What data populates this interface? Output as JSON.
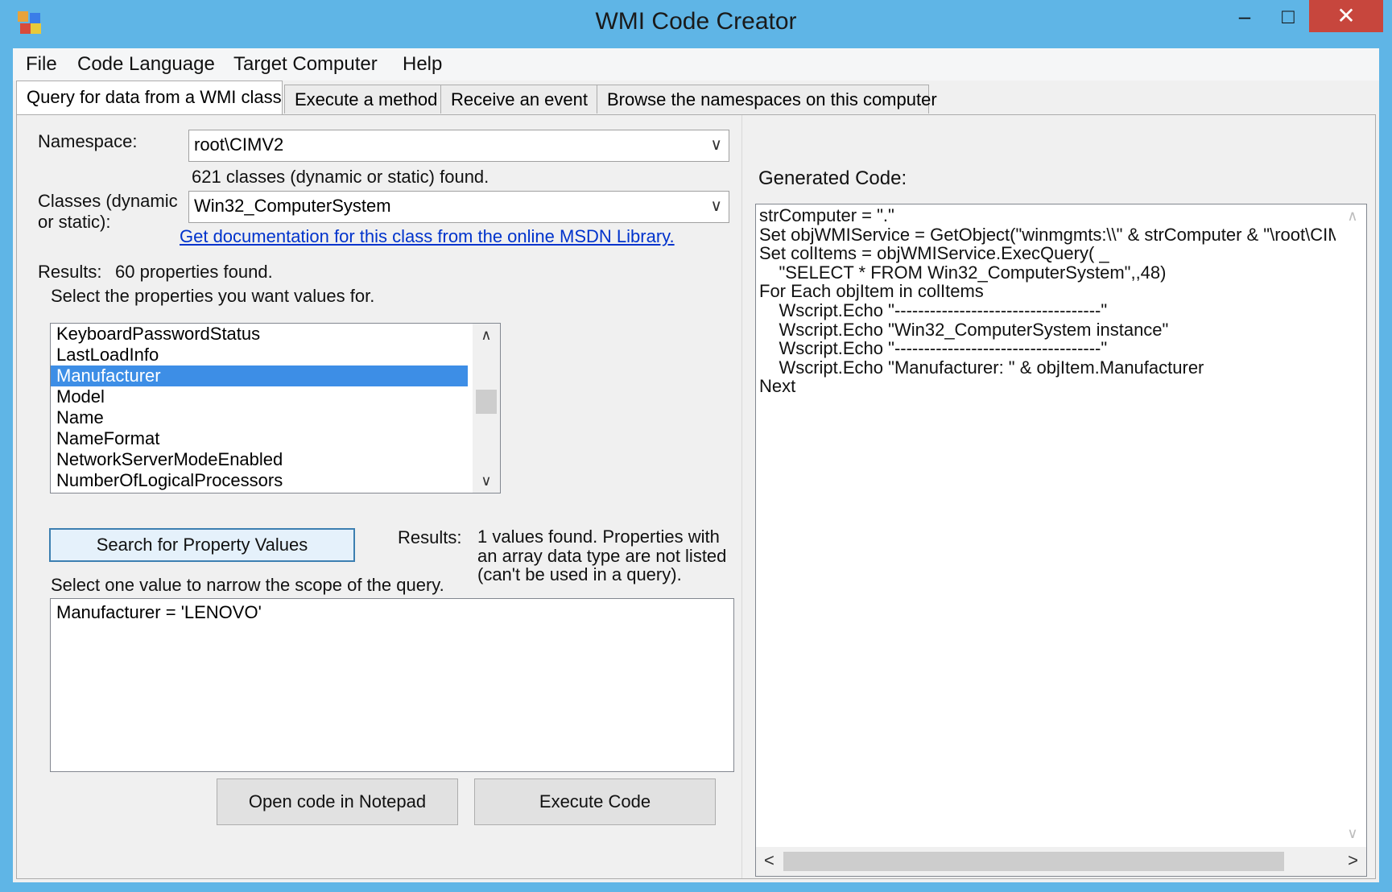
{
  "window": {
    "title": "WMI Code Creator",
    "minimize_glyph": "–",
    "maximize_glyph": "□",
    "close_glyph": "✕"
  },
  "menu": [
    "File",
    "Code Language",
    "Target Computer",
    "Help"
  ],
  "tabs": [
    {
      "label": "Query for data from a WMI class",
      "active": true
    },
    {
      "label": "Execute a method",
      "active": false
    },
    {
      "label": "Receive an event",
      "active": false
    },
    {
      "label": "Browse the namespaces on this computer",
      "active": false
    }
  ],
  "query": {
    "namespace_label": "Namespace:",
    "namespace_value": "root\\CIMV2",
    "classes_found": "621 classes (dynamic or static) found.",
    "classes_label_line1": "Classes (dynamic",
    "classes_label_line2": "or static):",
    "class_value": "Win32_ComputerSystem",
    "doc_link": "Get documentation for this class from the online MSDN Library.",
    "results_label": "Results:",
    "properties_found": "60 properties found.",
    "select_properties": "Select the properties you want values for.",
    "properties": [
      {
        "name": "KeyboardPasswordStatus",
        "selected": false
      },
      {
        "name": "LastLoadInfo",
        "selected": false
      },
      {
        "name": "Manufacturer",
        "selected": true
      },
      {
        "name": "Model",
        "selected": false
      },
      {
        "name": "Name",
        "selected": false
      },
      {
        "name": "NameFormat",
        "selected": false
      },
      {
        "name": "NetworkServerModeEnabled",
        "selected": false
      },
      {
        "name": "NumberOfLogicalProcessors",
        "selected": false
      }
    ],
    "search_button": "Search for Property Values",
    "values_results_label": "Results:",
    "values_found_line1": "1 values found. Properties with",
    "values_found_line2": "an array data type are not listed",
    "values_found_line3": "(can't be used in a query).",
    "select_value": "Select one value to narrow the scope of the query.",
    "values": [
      "Manufacturer = 'LENOVO'"
    ],
    "open_notepad_button": "Open code in Notepad",
    "execute_button": "Execute Code"
  },
  "code": {
    "label": "Generated Code:",
    "lines": [
      "strComputer = \".\"",
      "Set objWMIService = GetObject(\"winmgmts:\\\\\" & strComputer & \"\\root\\CIMV",
      "Set colItems = objWMIService.ExecQuery( _",
      "    \"SELECT * FROM Win32_ComputerSystem\",,48)",
      "For Each objItem in colItems",
      "    Wscript.Echo \"-----------------------------------\"",
      "    Wscript.Echo \"Win32_ComputerSystem instance\"",
      "    Wscript.Echo \"-----------------------------------\"",
      "    Wscript.Echo \"Manufacturer: \" & objItem.Manufacturer",
      "Next"
    ]
  },
  "scroll_glyphs": {
    "up": "∧",
    "down": "∨",
    "left": "<",
    "right": ">",
    "combo": "∨"
  },
  "colors": {
    "titlebar": "#5fb5e6",
    "close": "#c7463d",
    "selection": "#3d8ee6",
    "link": "#0033cc"
  }
}
